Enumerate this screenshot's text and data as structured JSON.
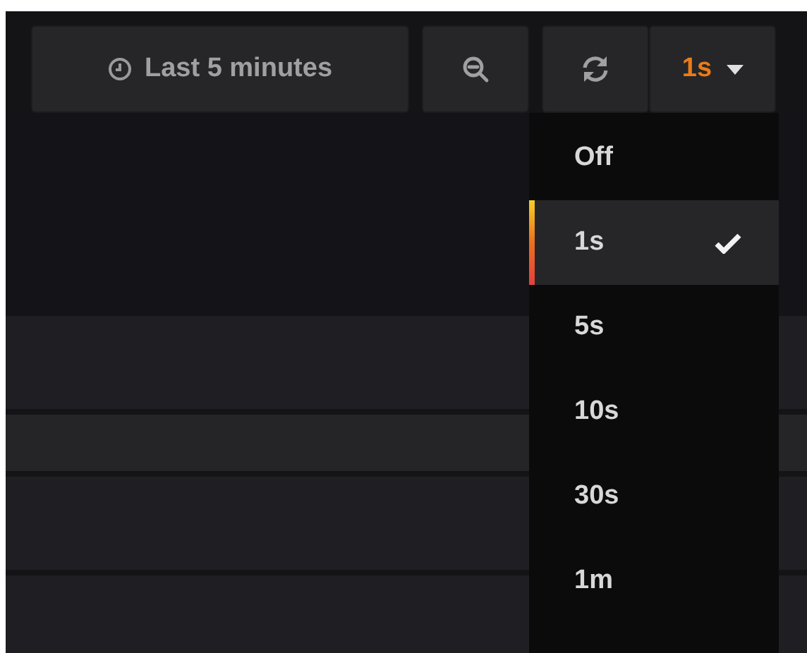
{
  "toolbar": {
    "time_range": "Last 5 minutes",
    "refresh_interval": "1s"
  },
  "interval_menu": {
    "options": [
      {
        "label": "Off",
        "selected": false
      },
      {
        "label": "1s",
        "selected": true
      },
      {
        "label": "5s",
        "selected": false
      },
      {
        "label": "10s",
        "selected": false
      },
      {
        "label": "30s",
        "selected": false
      },
      {
        "label": "1m",
        "selected": false
      }
    ]
  }
}
